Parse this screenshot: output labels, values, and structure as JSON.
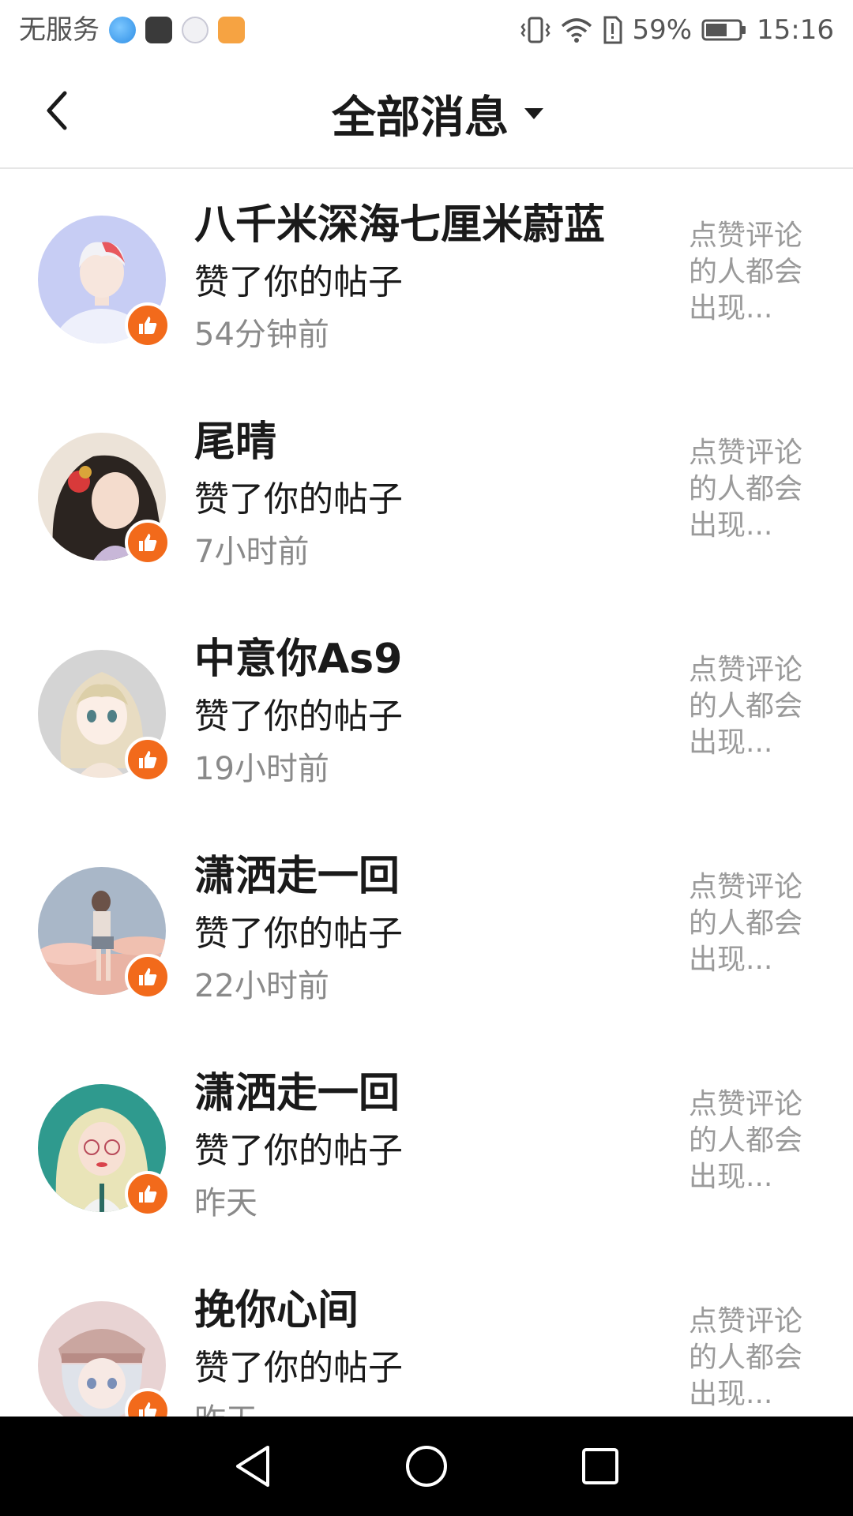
{
  "status_bar": {
    "carrier": "无服务",
    "battery_percent": "59%",
    "time": "15:16"
  },
  "header": {
    "title": "全部消息"
  },
  "messages": [
    {
      "name": "八千米深海七厘米蔚蓝",
      "action": "赞了你的帖子",
      "time": "54分钟前",
      "preview": "点赞评论的人都会出现..."
    },
    {
      "name": "尾晴",
      "action": "赞了你的帖子",
      "time": "7小时前",
      "preview": "点赞评论的人都会出现..."
    },
    {
      "name": "中意你As9",
      "action": "赞了你的帖子",
      "time": "19小时前",
      "preview": "点赞评论的人都会出现..."
    },
    {
      "name": "潇洒走一回",
      "action": "赞了你的帖子",
      "time": "22小时前",
      "preview": "点赞评论的人都会出现..."
    },
    {
      "name": "潇洒走一回",
      "action": "赞了你的帖子",
      "time": "昨天",
      "preview": "点赞评论的人都会出现..."
    },
    {
      "name": "挽你心间",
      "action": "赞了你的帖子",
      "time": "昨天",
      "preview": "点赞评论的人都会出现..."
    }
  ],
  "colors": {
    "like_badge": "#f26a1b",
    "time_text": "#8a8a8a",
    "preview_text": "#9a9a9a",
    "nav_bar": "#000000"
  },
  "icons": {
    "back": "chevron-left-icon",
    "title_dropdown": "caret-down-icon",
    "like": "thumbs-up-icon",
    "nav_back": "triangle-back-icon",
    "nav_home": "circle-home-icon",
    "nav_recents": "square-recents-icon"
  }
}
